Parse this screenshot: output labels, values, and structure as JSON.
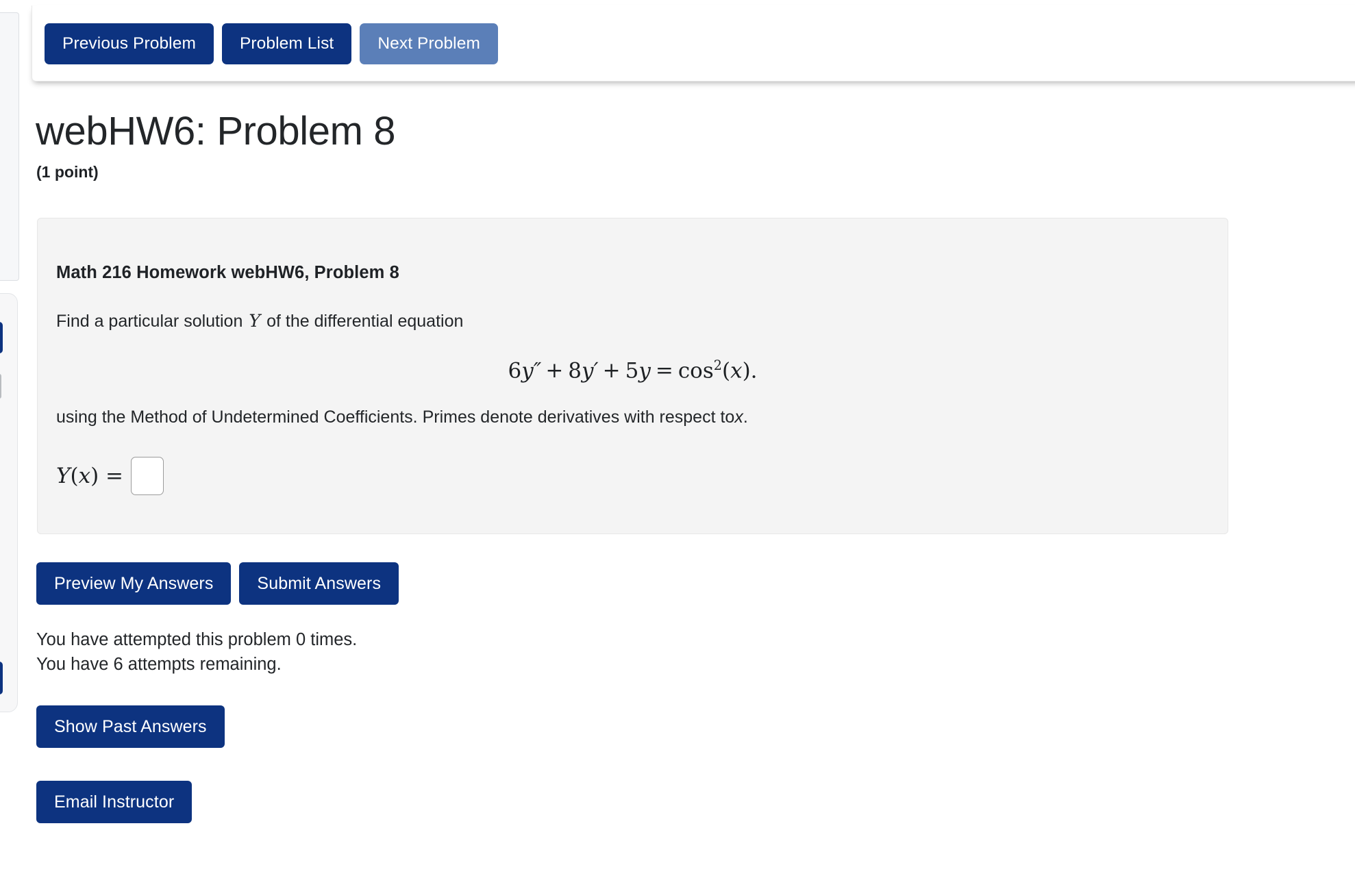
{
  "nav": {
    "previous_label": "Previous Problem",
    "problem_list_label": "Problem List",
    "next_label": "Next Problem",
    "primary_color": "#0d3380",
    "secondary_color": "#5b7fb8"
  },
  "header": {
    "title": "webHW6: Problem 8",
    "points": "(1 point)"
  },
  "problem": {
    "heading": "Math 216 Homework webHW6, Problem 8",
    "prompt_before_var": "Find a particular solution",
    "prompt_var": "Y",
    "prompt_after_var": "of the differential equation",
    "equation": {
      "coefficient_second": "6",
      "y_second": "y",
      "prime_second": "″",
      "plus_1": "+",
      "coefficient_first": "8",
      "y_first": "y",
      "prime_first": "′",
      "plus_2": "+",
      "coefficient_zero": "5",
      "y_zero": "y",
      "equals": "=",
      "rhs_function": "cos",
      "rhs_power": "2",
      "rhs_open": "(",
      "rhs_arg": "x",
      "rhs_close": ")",
      "period": ".",
      "plain": "6y'' + 8y' + 5y = cos^2(x)."
    },
    "note_before_var": "using the Method of Undetermined Coefficients. Primes denote derivatives with respect to",
    "note_var": "x",
    "note_after_var": ".",
    "answer_label_lhs": "Y",
    "answer_label_open": "(",
    "answer_label_arg": "x",
    "answer_label_close": ")",
    "answer_label_equals": "=",
    "answer_value": "",
    "answer_placeholder": ""
  },
  "actions": {
    "preview_label": "Preview My Answers",
    "submit_label": "Submit Answers",
    "past_answers_label": "Show Past Answers",
    "email_instructor_label": "Email Instructor"
  },
  "status": {
    "attempted_line": "You have attempted this problem 0 times.",
    "remaining_line": "You have 6 attempts remaining."
  }
}
